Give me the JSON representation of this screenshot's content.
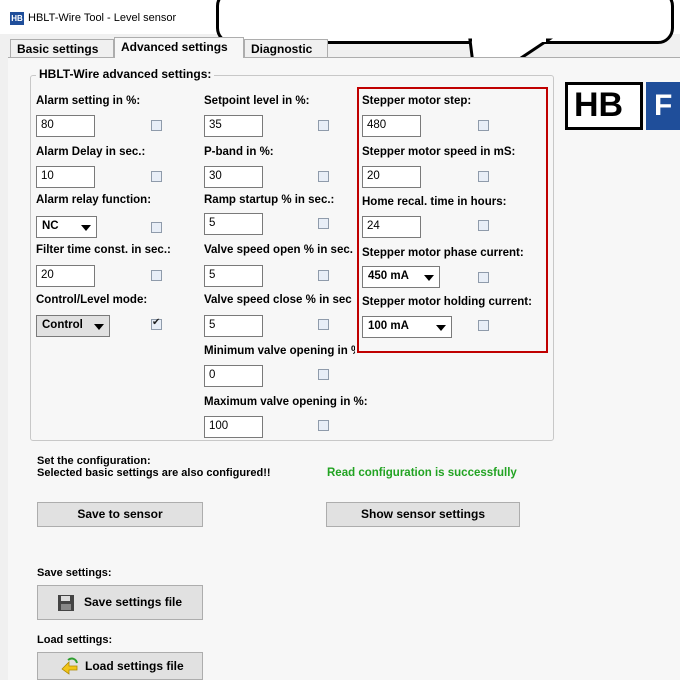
{
  "window": {
    "title": "HBLT-Wire Tool - Level sensor",
    "icon_text": "HB"
  },
  "tabs": [
    {
      "label": "Basic settings",
      "active": false
    },
    {
      "label": "Advanced settings",
      "active": true
    },
    {
      "label": "Diagnostic",
      "active": false
    }
  ],
  "group": {
    "title": "HBLT-Wire advanced settings:",
    "col1": {
      "alarm_setting_label": "Alarm setting in %:",
      "alarm_setting_value": "80",
      "alarm_delay_label": "Alarm Delay in sec.:",
      "alarm_delay_value": "10",
      "alarm_relay_label": "Alarm relay function:",
      "alarm_relay_value": "NC",
      "filter_label": "Filter time const. in sec.:",
      "filter_value": "20",
      "mode_label": "Control/Level mode:",
      "mode_value": "Control"
    },
    "col2": {
      "setpoint_label": "Setpoint level in %:",
      "setpoint_value": "35",
      "pband_label": "P-band in %:",
      "pband_value": "30",
      "ramp_label": "Ramp startup % in sec.:",
      "ramp_value": "5",
      "vopen_label": "Valve speed open % in sec.",
      "vopen_value": "5",
      "vclose_label": "Valve speed close % in sec",
      "vclose_value": "5",
      "vmin_label": "Minimum valve opening in %",
      "vmin_value": "0",
      "vmax_label": "Maximum valve opening in %:",
      "vmax_value": "100"
    },
    "col3": {
      "step_label": "Stepper motor step:",
      "step_value": "480",
      "speed_label": "Stepper motor speed in mS:",
      "speed_value": "20",
      "recal_label": "Home recal. time in hours:",
      "recal_value": "24",
      "phase_label": "Stepper motor phase current:",
      "phase_value": "450 mA",
      "holding_label": "Stepper motor holding current:",
      "holding_value": "100 mA"
    }
  },
  "config": {
    "heading_line1": "Set the configuration:",
    "heading_line2": "Selected basic settings are also configured!!",
    "status": "Read configuration is successfully",
    "status_color": "#22a322",
    "save_to_sensor": "Save to sensor",
    "show_settings": "Show sensor settings"
  },
  "save": {
    "heading": "Save settings:",
    "button": "Save settings file"
  },
  "load": {
    "heading": "Load settings:",
    "button": "Load settings file"
  },
  "logo": {
    "text": "HB",
    "text2": "F"
  },
  "accent": {
    "highlight": "#c00000",
    "brand": "#1f4e9a"
  }
}
